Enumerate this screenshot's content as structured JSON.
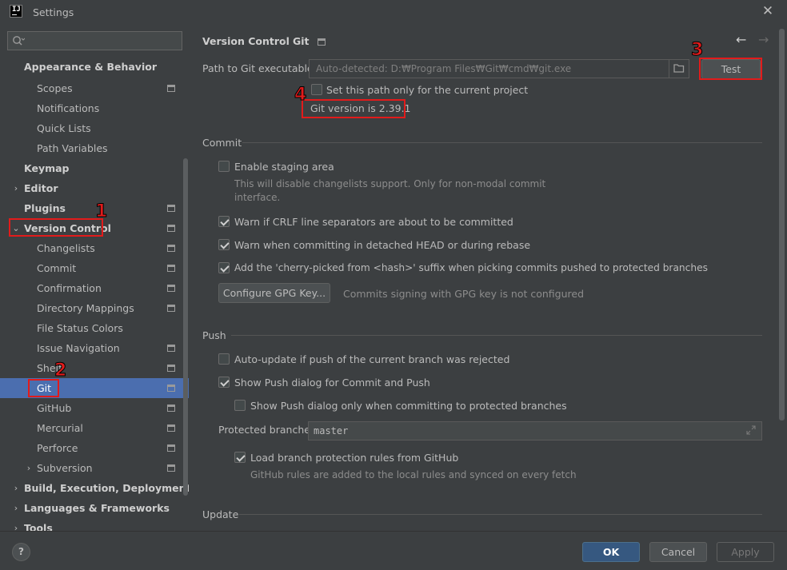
{
  "window": {
    "title": "Settings",
    "logo_text": "IJ"
  },
  "sidebar": {
    "search_placeholder": "",
    "items": [
      {
        "label": "Appearance & Behavior",
        "bold": true
      },
      {
        "label": "Scopes"
      },
      {
        "label": "Notifications"
      },
      {
        "label": "Quick Lists"
      },
      {
        "label": "Path Variables"
      },
      {
        "label": "Keymap",
        "bold": true
      },
      {
        "label": "Editor",
        "bold": true
      },
      {
        "label": "Plugins",
        "bold": true
      },
      {
        "label": "Version Control",
        "bold": true
      },
      {
        "label": "Changelists"
      },
      {
        "label": "Commit"
      },
      {
        "label": "Confirmation"
      },
      {
        "label": "Directory Mappings"
      },
      {
        "label": "File Status Colors"
      },
      {
        "label": "Issue Navigation"
      },
      {
        "label": "Shelf"
      },
      {
        "label": "Git",
        "selected": true
      },
      {
        "label": "GitHub"
      },
      {
        "label": "Mercurial"
      },
      {
        "label": "Perforce"
      },
      {
        "label": "Subversion"
      },
      {
        "label": "Build, Execution, Deployment",
        "bold": true
      },
      {
        "label": "Languages & Frameworks",
        "bold": true
      },
      {
        "label": "Tools",
        "bold": true
      }
    ]
  },
  "breadcrumb": {
    "parent": "Version Control",
    "separator": "›",
    "current": "Git"
  },
  "git_path": {
    "label": "Path to Git executable:",
    "placeholder": "Auto-detected: D:₩Program Files₩Git₩cmd₩git.exe",
    "test_button": "Test",
    "project_only_label": "Set this path only for the current project",
    "version_text": "Git version is 2.39.1"
  },
  "commit": {
    "title": "Commit",
    "staging_label": "Enable staging area",
    "staging_hint_line1": "This will disable changelists support. Only for non-modal commit",
    "staging_hint_line2": "interface.",
    "crlf_label": "Warn if CRLF line separators are about to be committed",
    "detached_label": "Warn when committing in detached HEAD or during rebase",
    "cherry_label": "Add the 'cherry-picked from <hash>' suffix when picking commits pushed to protected branches",
    "gpg_button": "Configure GPG Key...",
    "gpg_status": "Commits signing with GPG key is not configured"
  },
  "push": {
    "title": "Push",
    "auto_update_label": "Auto-update if push of the current branch was rejected",
    "show_dialog_label": "Show Push dialog for Commit and Push",
    "protected_only_label": "Show Push dialog only when committing to protected branches",
    "protected_branches_label": "Protected branches:",
    "protected_branches_value": "master",
    "load_rules_label": "Load branch protection rules from GitHub",
    "load_rules_hint": "GitHub rules are added to the local rules and synced on every fetch"
  },
  "update": {
    "title": "Update"
  },
  "footer": {
    "help": "?",
    "ok": "OK",
    "cancel": "Cancel",
    "apply": "Apply"
  },
  "annotations": {
    "n1": "1",
    "n2": "2",
    "n3": "3",
    "n4": "4"
  },
  "colors": {
    "background": "#3c3f41",
    "selection": "#4b6eaf",
    "highlight": "#e21b1b",
    "ok_button": "#365880"
  }
}
